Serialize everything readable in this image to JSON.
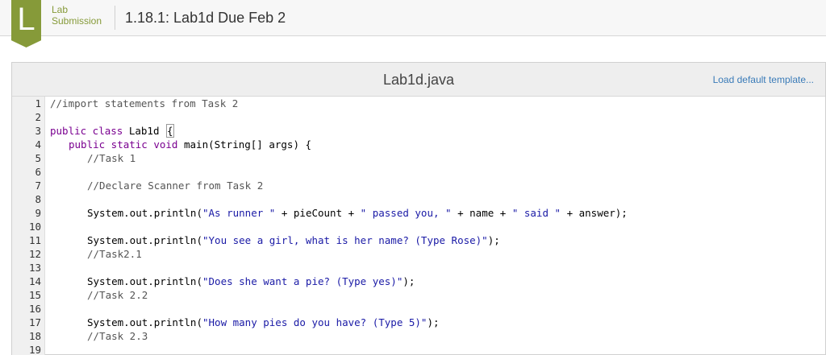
{
  "header": {
    "badge_letter": "L",
    "badge_label": "Lab\nSubmission",
    "title": "1.18.1: Lab1d Due Feb 2"
  },
  "editor": {
    "file_name": "Lab1d.java",
    "load_template_label": "Load default template..."
  },
  "code_lines": [
    {
      "n": "1",
      "indent": 0,
      "tokens": [
        {
          "t": "//import statements from Task 2",
          "c": "cmt"
        }
      ]
    },
    {
      "n": "2",
      "indent": 0,
      "tokens": []
    },
    {
      "n": "3",
      "indent": 0,
      "tokens": [
        {
          "t": "public class Lab1d ",
          "c": "kw_mixed"
        },
        {
          "t": "{",
          "c": "bracket"
        }
      ]
    },
    {
      "n": "4",
      "indent": 1,
      "tokens": [
        {
          "t": "public static void ",
          "c": "kw"
        },
        {
          "t": "main(String[] args) {",
          "c": ""
        }
      ]
    },
    {
      "n": "5",
      "indent": 2,
      "tokens": [
        {
          "t": "//Task 1",
          "c": "cmt"
        }
      ]
    },
    {
      "n": "6",
      "indent": 0,
      "tokens": []
    },
    {
      "n": "7",
      "indent": 2,
      "tokens": [
        {
          "t": "//Declare Scanner from Task 2",
          "c": "cmt"
        }
      ]
    },
    {
      "n": "8",
      "indent": 0,
      "tokens": []
    },
    {
      "n": "9",
      "indent": 2,
      "tokens": [
        {
          "t": "System.out.println(",
          "c": ""
        },
        {
          "t": "\"As runner \"",
          "c": "str"
        },
        {
          "t": " + pieCount + ",
          "c": ""
        },
        {
          "t": "\" passed you, \"",
          "c": "str"
        },
        {
          "t": " + name + ",
          "c": ""
        },
        {
          "t": "\" said \"",
          "c": "str"
        },
        {
          "t": " + answer);",
          "c": ""
        }
      ]
    },
    {
      "n": "10",
      "indent": 0,
      "tokens": []
    },
    {
      "n": "11",
      "indent": 2,
      "tokens": [
        {
          "t": "System.out.println(",
          "c": ""
        },
        {
          "t": "\"You see a girl, what is her name? (Type Rose)\"",
          "c": "str"
        },
        {
          "t": ");",
          "c": ""
        }
      ]
    },
    {
      "n": "12",
      "indent": 2,
      "tokens": [
        {
          "t": "//Task2.1",
          "c": "cmt"
        }
      ]
    },
    {
      "n": "13",
      "indent": 0,
      "tokens": []
    },
    {
      "n": "14",
      "indent": 2,
      "tokens": [
        {
          "t": "System.out.println(",
          "c": ""
        },
        {
          "t": "\"Does she want a pie? (Type yes)\"",
          "c": "str"
        },
        {
          "t": ");",
          "c": ""
        }
      ]
    },
    {
      "n": "15",
      "indent": 2,
      "tokens": [
        {
          "t": "//Task 2.2",
          "c": "cmt"
        }
      ]
    },
    {
      "n": "16",
      "indent": 0,
      "tokens": []
    },
    {
      "n": "17",
      "indent": 2,
      "tokens": [
        {
          "t": "System.out.println(",
          "c": ""
        },
        {
          "t": "\"How many pies do you have? (Type 5)\"",
          "c": "str"
        },
        {
          "t": ");",
          "c": ""
        }
      ]
    },
    {
      "n": "18",
      "indent": 2,
      "tokens": [
        {
          "t": "//Task 2.3",
          "c": "cmt"
        }
      ]
    },
    {
      "n": "19",
      "indent": 0,
      "tokens": []
    }
  ]
}
